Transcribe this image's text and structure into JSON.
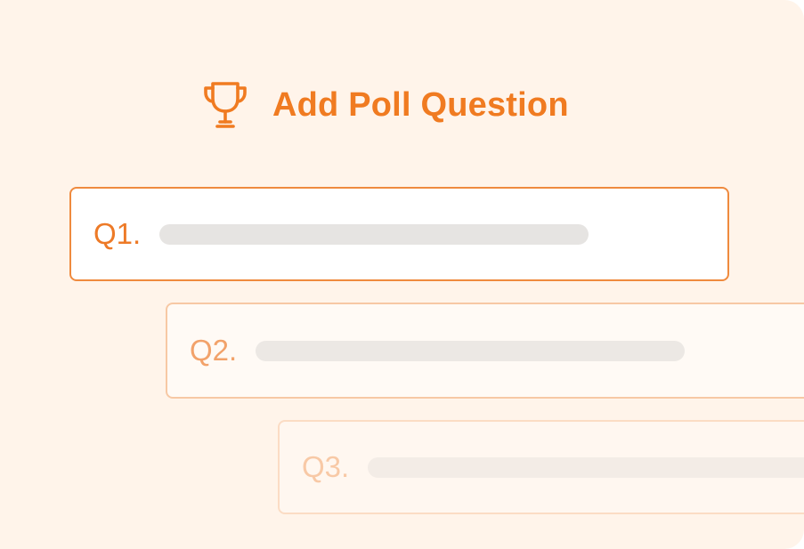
{
  "header": {
    "title": "Add Poll Question",
    "icon": "trophy-icon",
    "accent_color": "#f07b21"
  },
  "questions": [
    {
      "label": "Q1."
    },
    {
      "label": "Q2."
    },
    {
      "label": "Q3."
    }
  ]
}
